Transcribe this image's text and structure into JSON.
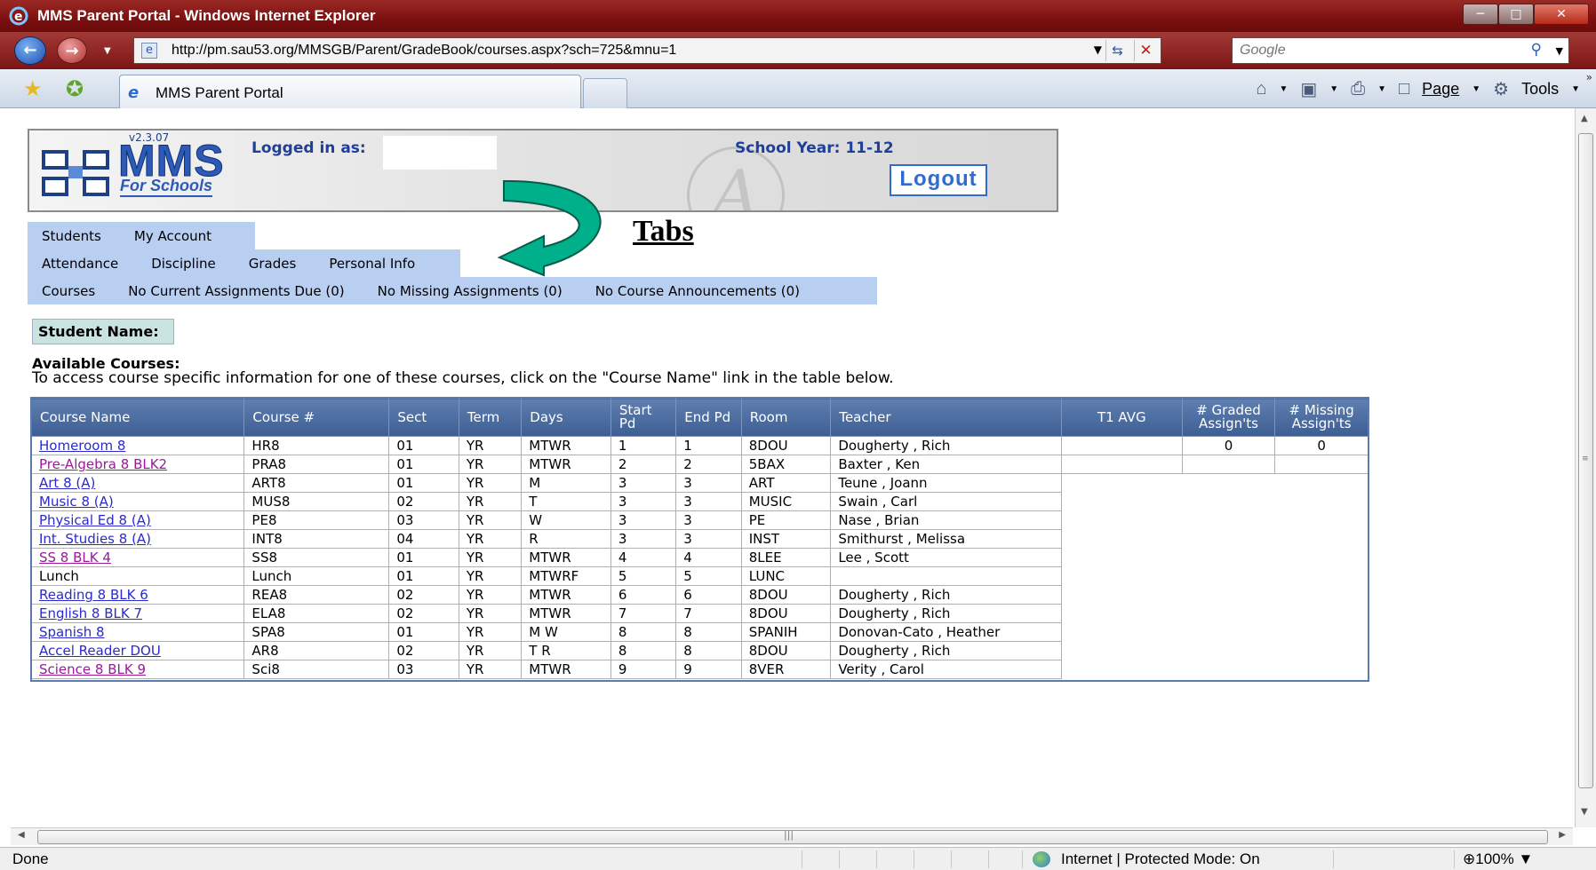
{
  "browser": {
    "title": "MMS Parent Portal - Windows Internet Explorer",
    "url": "http://pm.sau53.org/MMSGB/Parent/GradeBook/courses.aspx?sch=725&mnu=1",
    "search_placeholder": "Google",
    "tab_label": "MMS Parent Portal",
    "page_menu": "Page",
    "tools_menu": "Tools",
    "status_text": "Done",
    "zone_text": "Internet | Protected Mode: On",
    "zoom": "100%"
  },
  "portal": {
    "version": "v2.3.07",
    "logo_text": "MMS",
    "logo_sub": "For Schools",
    "logged_in_label": "Logged in as:",
    "school_year": "School Year: 11-12",
    "logout_label": "Logout",
    "tabs_row1": [
      "Students",
      "My Account"
    ],
    "tabs_row2": [
      "Attendance",
      "Discipline",
      "Grades",
      "Personal Info"
    ],
    "tabs_row3": [
      "Courses",
      "No Current Assignments Due (0)",
      "No Missing Assignments (0)",
      "No Course Announcements (0)"
    ],
    "callout": "Tabs",
    "student_name_label": "Student Name:",
    "available_title": "Available Courses:",
    "available_desc": "To access course specific information for one of these courses, click on the \"Course Name\" link in the table below."
  },
  "table": {
    "headers": [
      "Course Name",
      "Course #",
      "Sect",
      "Term",
      "Days",
      "Start Pd",
      "End Pd",
      "Room",
      "Teacher",
      "T1 AVG",
      "# Graded Assign'ts",
      "# Missing Assign'ts"
    ],
    "rows": [
      {
        "name": "Homeroom 8",
        "link": true,
        "visited": false,
        "num": "HR8",
        "sect": "01",
        "term": "YR",
        "days": "MTWR",
        "start": "1",
        "end": "1",
        "room": "8DOU",
        "teacher": "Dougherty , Rich",
        "avg": "",
        "graded": "0",
        "missing": "0"
      },
      {
        "name": "Pre-Algebra 8 BLK2",
        "link": true,
        "visited": true,
        "num": "PRA8",
        "sect": "01",
        "term": "YR",
        "days": "MTWR",
        "start": "2",
        "end": "2",
        "room": "5BAX",
        "teacher": "Baxter , Ken",
        "avg": "",
        "graded": "",
        "missing": ""
      },
      {
        "name": "Art 8 (A)",
        "link": true,
        "visited": false,
        "num": "ART8",
        "sect": "01",
        "term": "YR",
        "days": "M",
        "start": "3",
        "end": "3",
        "room": "ART",
        "teacher": "Teune , Joann"
      },
      {
        "name": "Music 8 (A)",
        "link": true,
        "visited": false,
        "num": "MUS8",
        "sect": "02",
        "term": "YR",
        "days": "T",
        "start": "3",
        "end": "3",
        "room": "MUSIC",
        "teacher": "Swain , Carl"
      },
      {
        "name": "Physical Ed 8 (A)",
        "link": true,
        "visited": false,
        "num": "PE8",
        "sect": "03",
        "term": "YR",
        "days": "W",
        "start": "3",
        "end": "3",
        "room": "PE",
        "teacher": "Nase , Brian"
      },
      {
        "name": "Int. Studies 8 (A)",
        "link": true,
        "visited": false,
        "num": "INT8",
        "sect": "04",
        "term": "YR",
        "days": "R",
        "start": "3",
        "end": "3",
        "room": "INST",
        "teacher": "Smithurst , Melissa"
      },
      {
        "name": "SS 8 BLK 4",
        "link": true,
        "visited": true,
        "num": "SS8",
        "sect": "01",
        "term": "YR",
        "days": "MTWR",
        "start": "4",
        "end": "4",
        "room": "8LEE",
        "teacher": "Lee , Scott"
      },
      {
        "name": "Lunch",
        "link": false,
        "visited": false,
        "num": "Lunch",
        "sect": "01",
        "term": "YR",
        "days": "MTWRF",
        "start": "5",
        "end": "5",
        "room": "LUNC",
        "teacher": ""
      },
      {
        "name": "Reading 8 BLK 6",
        "link": true,
        "visited": false,
        "num": "REA8",
        "sect": "02",
        "term": "YR",
        "days": "MTWR",
        "start": "6",
        "end": "6",
        "room": "8DOU",
        "teacher": "Dougherty , Rich"
      },
      {
        "name": "English 8 BLK 7",
        "link": true,
        "visited": false,
        "num": "ELA8",
        "sect": "02",
        "term": "YR",
        "days": "MTWR",
        "start": "7",
        "end": "7",
        "room": "8DOU",
        "teacher": "Dougherty , Rich"
      },
      {
        "name": "Spanish 8",
        "link": true,
        "visited": false,
        "num": "SPA8",
        "sect": "01",
        "term": "YR",
        "days": "M W",
        "start": "8",
        "end": "8",
        "room": "SPANIH",
        "teacher": "Donovan-Cato , Heather"
      },
      {
        "name": "Accel Reader DOU",
        "link": true,
        "visited": false,
        "num": "AR8",
        "sect": "02",
        "term": "YR",
        "days": "T R",
        "start": "8",
        "end": "8",
        "room": "8DOU",
        "teacher": "Dougherty , Rich"
      },
      {
        "name": "Science 8 BLK 9",
        "link": true,
        "visited": true,
        "num": "Sci8",
        "sect": "03",
        "term": "YR",
        "days": "MTWR",
        "start": "9",
        "end": "9",
        "room": "8VER",
        "teacher": "Verity , Carol"
      }
    ]
  },
  "colors": {
    "titlebar": "#7c1010",
    "tab_bg": "#b9cff2",
    "table_header": "#4a6aa0",
    "link": "#2a2ad0",
    "visited_link": "#9a1a9a",
    "callout_arrow": "#00b08a"
  }
}
